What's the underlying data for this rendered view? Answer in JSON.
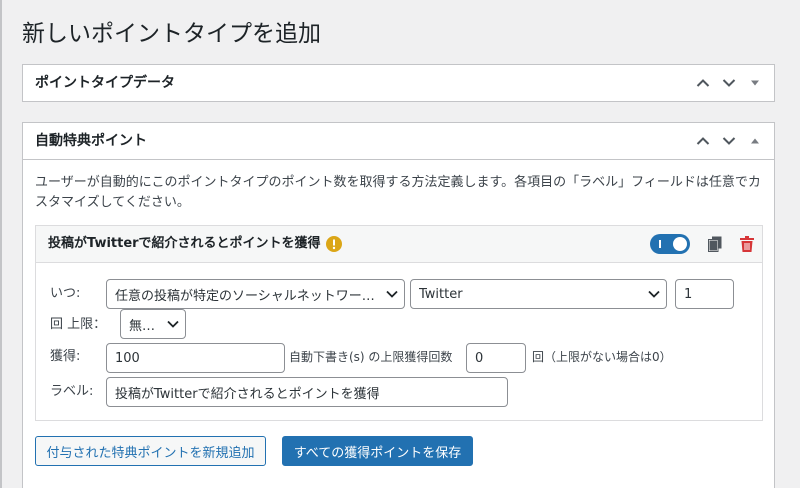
{
  "page": {
    "title": "新しいポイントタイプを追加"
  },
  "colors": {
    "accent": "#2271b1",
    "warning": "#dba617",
    "delete": "#d63638"
  },
  "box_data": {
    "title": "ポイントタイプデータ",
    "icons": [
      "chevron-up-icon",
      "chevron-down-icon",
      "toggle-arrow-down-icon"
    ]
  },
  "box_auto": {
    "title": "自動特典ポイント",
    "icons": [
      "chevron-up-icon",
      "chevron-down-icon",
      "toggle-arrow-up-icon"
    ],
    "description": "ユーザーが自動的にこのポイントタイプのポイント数を取得する方法定義します。各項目の「ラベル」フィールドは任意でカスタマイズしてください。",
    "award": {
      "title": "投稿がTwitterで紹介されるとポイントを獲得",
      "enabled": true,
      "icons": [
        "warning-icon",
        "toggle-switch",
        "copy-icon",
        "trash-icon"
      ],
      "when_label": "いつ:",
      "event_select": "任意の投稿が特定のソーシャルネットワーク...",
      "network_select": "Twitter",
      "count_value": "1",
      "limit_label": "回 上限：",
      "limit_select": "無制限",
      "earn_label": "獲得:",
      "points_value": "100",
      "max_earnings_label": "自動下書き(s) の上限獲得回数",
      "max_earnings_value": "0",
      "max_earnings_suffix": "回（上限がない場合は0）",
      "label_label": "ラベル:",
      "label_value": "投稿がTwitterで紹介されるとポイントを獲得"
    },
    "add_button": "付与された特典ポイントを新規追加",
    "save_button": "すべての獲得ポイントを保存"
  }
}
